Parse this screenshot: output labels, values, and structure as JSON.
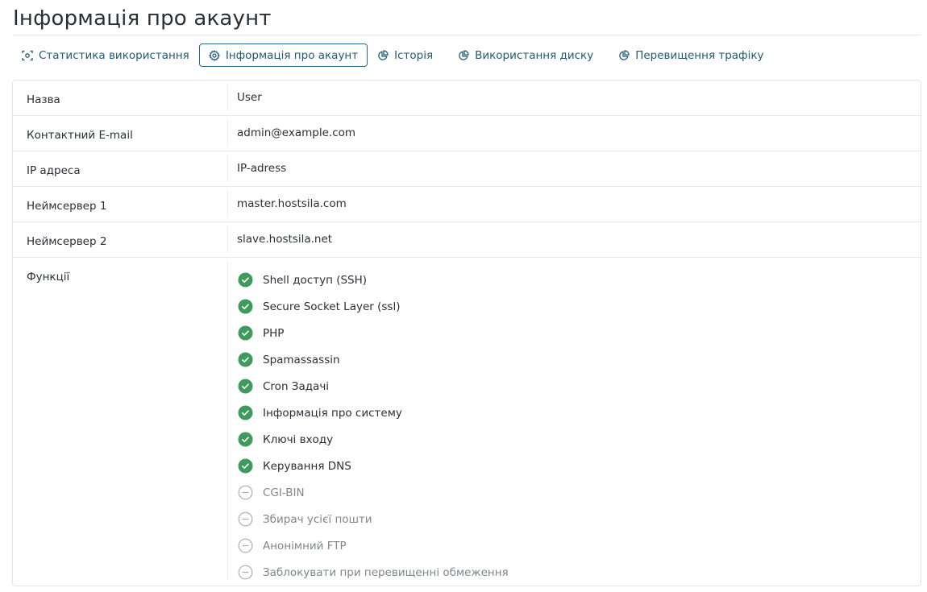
{
  "page": {
    "title": "Інформація про акаунт"
  },
  "tabs": [
    {
      "label": "Статистика використання",
      "icon": "scan-icon",
      "active": false
    },
    {
      "label": "Інформація про акаунт",
      "icon": "gear-icon",
      "active": true
    },
    {
      "label": "Історія",
      "icon": "pie-chart-icon",
      "active": false
    },
    {
      "label": "Використання диску",
      "icon": "pie-chart-icon",
      "active": false
    },
    {
      "label": "Перевищення трафіку",
      "icon": "pie-chart-icon",
      "active": false
    }
  ],
  "account": {
    "rows": [
      {
        "label": "Назва",
        "value": "User"
      },
      {
        "label": "Контактний E-mail",
        "value": "admin@example.com"
      },
      {
        "label": "IP адреса",
        "value": "IP-adress"
      },
      {
        "label": "Неймсервер 1",
        "value": "master.hostsila.com"
      },
      {
        "label": "Неймсервер 2",
        "value": "slave.hostsila.net"
      }
    ],
    "features_label": "Функції",
    "features": [
      {
        "label": "Shell доступ (SSH)",
        "enabled": true
      },
      {
        "label": "Secure Socket Layer (ssl)",
        "enabled": true
      },
      {
        "label": "PHP",
        "enabled": true
      },
      {
        "label": "Spamassassin",
        "enabled": true
      },
      {
        "label": "Cron Задачі",
        "enabled": true
      },
      {
        "label": "Інформація про систему",
        "enabled": true
      },
      {
        "label": "Ключі входу",
        "enabled": true
      },
      {
        "label": "Керування DNS",
        "enabled": true
      },
      {
        "label": "CGI-BIN",
        "enabled": false
      },
      {
        "label": "Збирач усієї пошти",
        "enabled": false
      },
      {
        "label": "Анонімний FTP",
        "enabled": false
      },
      {
        "label": "Заблокувати при перевищенні обмеження",
        "enabled": false
      }
    ]
  },
  "colors": {
    "accent": "#1f5a74",
    "enabled": "#3f9a5e",
    "disabled": "#a9aeb3"
  }
}
